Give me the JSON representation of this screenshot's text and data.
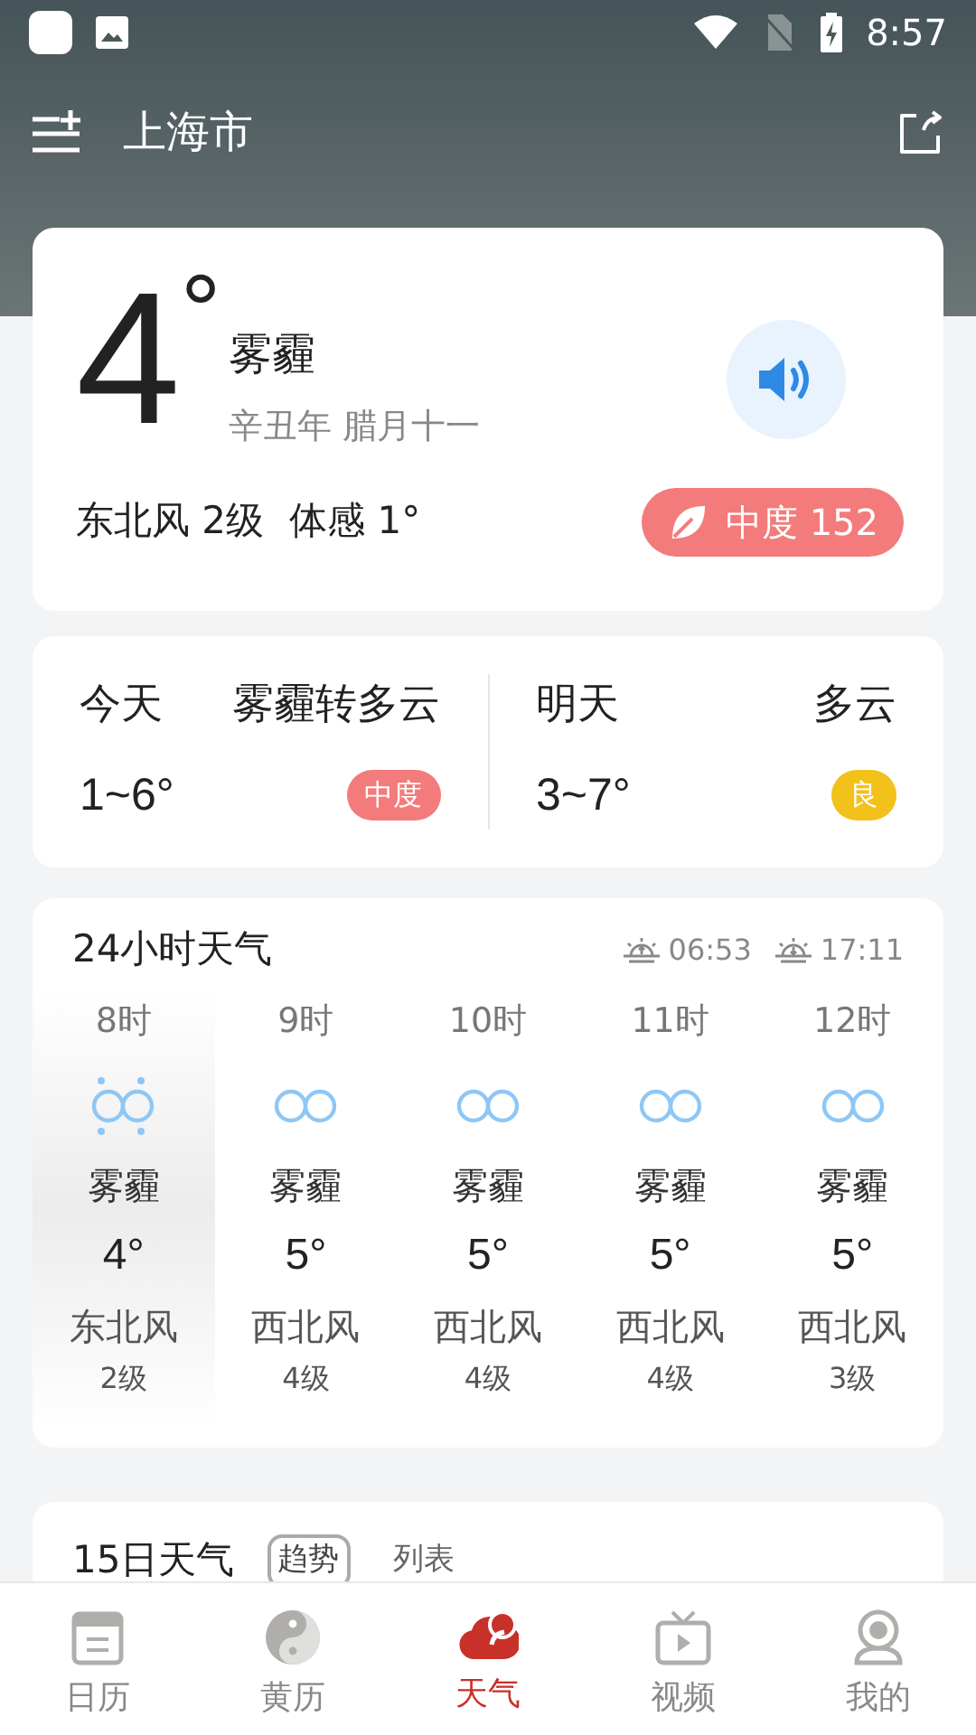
{
  "status_bar": {
    "time": "8:57"
  },
  "header": {
    "city": "上海市"
  },
  "current": {
    "temp": "4",
    "degree": "°",
    "condition": "雾霾",
    "lunar": "辛丑年 腊月十一",
    "wind": "东北风 2级",
    "feels": "体感 1°",
    "aqi": {
      "label": "中度 152",
      "color": "#f37b7b"
    }
  },
  "forecast": [
    {
      "day": "今天",
      "condition": "雾霾转多云",
      "range": "1~6°",
      "aqi": "中度",
      "color": "#f37b7b"
    },
    {
      "day": "明天",
      "condition": "多云",
      "range": "3~7°",
      "aqi": "良",
      "color": "#f2c21b"
    }
  ],
  "hourly": {
    "title": "24小时天气",
    "sunrise": "06:53",
    "sunset": "17:11",
    "hours": [
      {
        "time": "8时",
        "condition": "雾霾",
        "temp": "4°",
        "wind": "东北风",
        "level": "2级",
        "selected": true
      },
      {
        "time": "9时",
        "condition": "雾霾",
        "temp": "5°",
        "wind": "西北风",
        "level": "4级",
        "selected": false
      },
      {
        "time": "10时",
        "condition": "雾霾",
        "temp": "5°",
        "wind": "西北风",
        "level": "4级",
        "selected": false
      },
      {
        "time": "11时",
        "condition": "雾霾",
        "temp": "5°",
        "wind": "西北风",
        "level": "4级",
        "selected": false
      },
      {
        "time": "12时",
        "condition": "雾霾",
        "temp": "5°",
        "wind": "西北风",
        "level": "3级",
        "selected": false
      }
    ]
  },
  "daily": {
    "title": "15日天气",
    "tabs": [
      {
        "label": "趋势",
        "selected": true
      },
      {
        "label": "列表",
        "selected": false
      }
    ]
  },
  "nav": [
    {
      "label": "日历",
      "kind": "calendar",
      "selected": false
    },
    {
      "label": "黄历",
      "kind": "yinyang",
      "selected": false
    },
    {
      "label": "天气",
      "kind": "weather",
      "selected": true
    },
    {
      "label": "视频",
      "kind": "tv",
      "selected": false
    },
    {
      "label": "我的",
      "kind": "user",
      "selected": false
    }
  ]
}
